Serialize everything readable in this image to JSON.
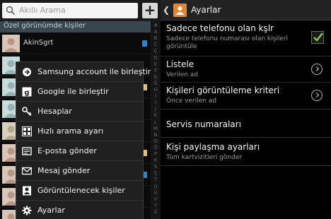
{
  "search": {
    "placeholder": "Akıllı Arama"
  },
  "contacts_panel": {
    "section_header": "Özel görünümde kişiler",
    "contacts": [
      {
        "name": "AkinSgrt"
      },
      {
        "name": ""
      },
      {
        "name": ""
      },
      {
        "name": ""
      },
      {
        "name": ""
      },
      {
        "name": ""
      },
      {
        "name": ""
      },
      {
        "name": ""
      },
      {
        "name": ""
      }
    ],
    "index_letters": [
      "#",
      "A",
      "B",
      "C",
      "Ç",
      "D",
      "E",
      "F",
      "G",
      "Ğ",
      "H",
      "I",
      "İ",
      "J",
      "K",
      "L",
      "M",
      "N",
      "O",
      "Ö",
      "P",
      "R",
      "S",
      "Ş",
      "T",
      "U",
      "Ü",
      "V",
      "Y",
      "Z"
    ]
  },
  "menu": {
    "items": [
      {
        "label": "Samsung account ile birleştir",
        "icon": "link-icon"
      },
      {
        "label": "Google ile birleştir",
        "icon": "google-icon"
      },
      {
        "label": "Hesaplar",
        "icon": "key-icon"
      },
      {
        "label": "Hızlı arama ayarı",
        "icon": "speed-dial-icon"
      },
      {
        "label": "E-posta gönder",
        "icon": "email-icon"
      },
      {
        "label": "Mesaj gönder",
        "icon": "message-icon"
      },
      {
        "label": "Görüntülenecek kişiler",
        "icon": "contact-card-icon"
      },
      {
        "label": "Ayarlar",
        "icon": "gear-icon"
      }
    ]
  },
  "settings": {
    "title": "Ayarlar",
    "items": [
      {
        "title": "Sadece telefonu olan kşlr",
        "subtitle": "Sadece telefonu numarası olan kişileri görüntüle",
        "control": "checkbox",
        "checked": true
      },
      {
        "title": "Listele",
        "subtitle": "Verilen ad",
        "control": "chevron"
      },
      {
        "title": "Kişileri görüntüleme kriteri",
        "subtitle": "Önce verilen ad",
        "control": "chevron"
      },
      {
        "title": "Servis numaraları",
        "subtitle": "",
        "control": "none"
      },
      {
        "title": "Kişi paylaşma ayarları",
        "subtitle": "Tüm kartvizitleri gönder",
        "control": "none"
      }
    ]
  },
  "colors": {
    "accent_check": "#8bc34a",
    "title_icon": "#e8842c",
    "badge_blue": "#1e88e5"
  }
}
